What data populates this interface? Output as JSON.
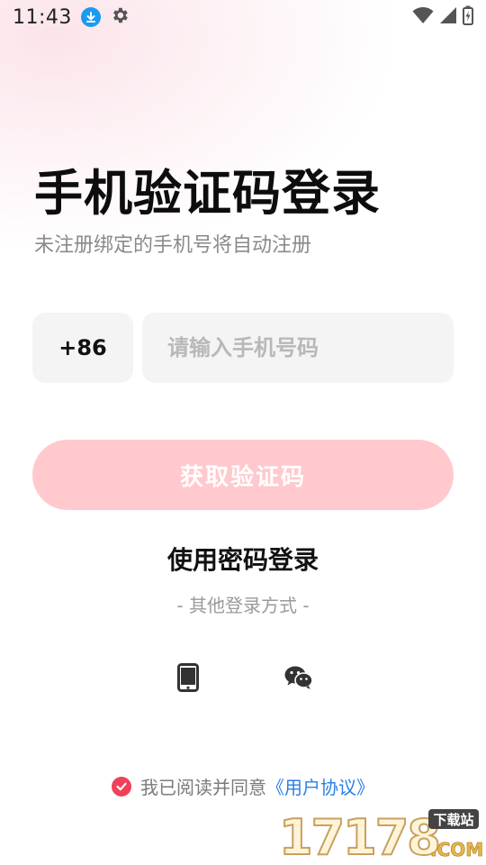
{
  "status_bar": {
    "time": "11:43",
    "icons": [
      "download-icon",
      "gear-icon",
      "wifi-icon",
      "signal-icon",
      "battery-icon"
    ]
  },
  "login": {
    "title": "手机验证码登录",
    "subtitle": "未注册绑定的手机号将自动注册",
    "country_code": "+86",
    "phone_placeholder": "请输入手机号码",
    "phone_value": "",
    "get_code_label": "获取验证码",
    "password_login_label": "使用密码登录",
    "other_methods_label": "- 其他登录方式 -",
    "alt_methods": [
      "phone-icon",
      "wechat-icon"
    ]
  },
  "agreement": {
    "checked": true,
    "text": "我已阅读并同意",
    "link_label": "《用户协议》"
  },
  "watermark": {
    "brand": "17178",
    "badge": "下载站",
    "suffix": ".COM"
  },
  "colors": {
    "accent": "#f0405a",
    "button_disabled": "#ffc9cd",
    "link": "#2d7fe6",
    "input_bg": "#f4f4f4"
  }
}
